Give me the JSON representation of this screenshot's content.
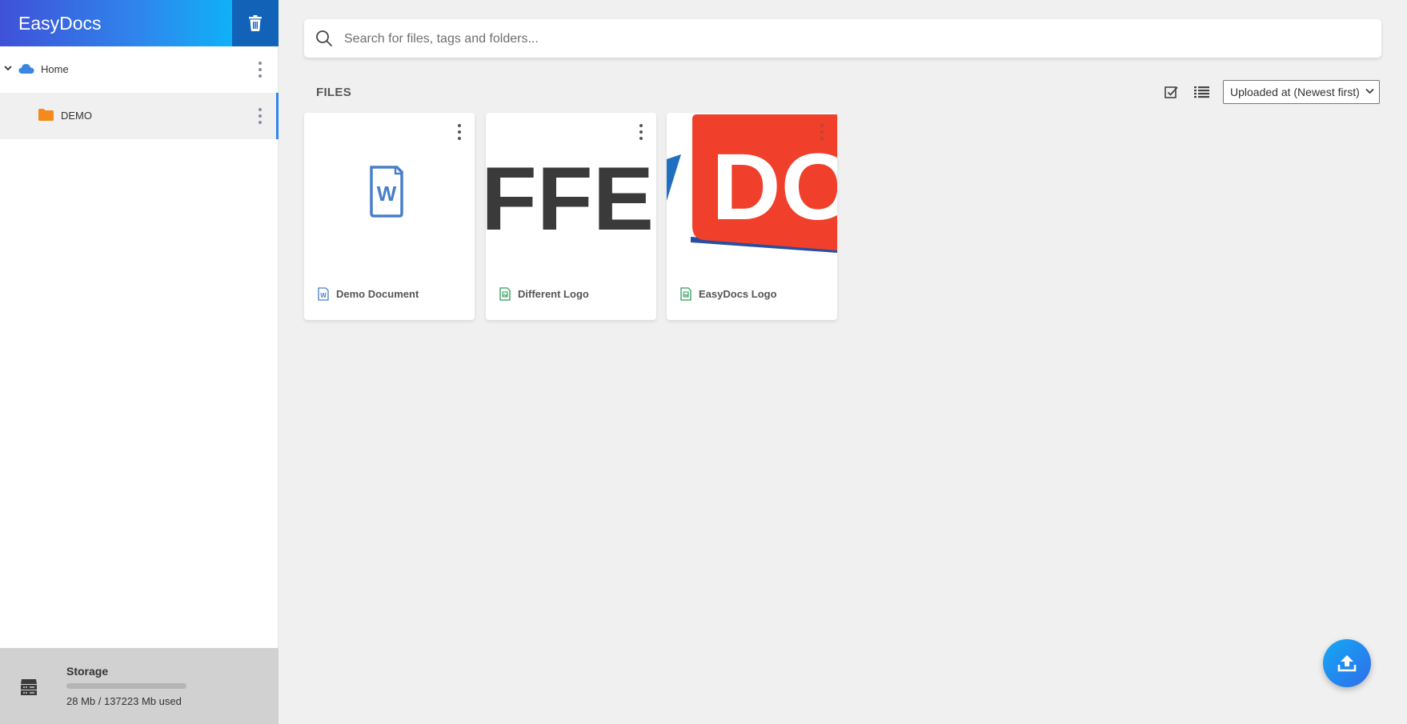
{
  "app": {
    "title": "EasyDocs"
  },
  "colors": {
    "brand_start": "#3f51d8",
    "brand_end": "#0fb1f7",
    "folder": "#f38a1e",
    "cloud": "#3a86e0",
    "word": "#4a7fc8",
    "image_icon": "#2e9d5a"
  },
  "sidebar": {
    "trash_icon": "trash-icon",
    "tree": [
      {
        "label": "Home",
        "icon": "cloud-icon",
        "expanded": true
      },
      {
        "label": "DEMO",
        "icon": "folder-icon",
        "selected": true
      }
    ],
    "storage": {
      "title": "Storage",
      "used_text": "28 Mb / 137223 Mb used",
      "used_fraction": 0.0002
    }
  },
  "search": {
    "placeholder": "Search for files, tags and folders..."
  },
  "files": {
    "heading": "FILES",
    "sort_label": "Uploaded at (Newest first)",
    "items": [
      {
        "name": "Demo Document",
        "type": "word",
        "thumb_text": "W"
      },
      {
        "name": "Different Logo",
        "type": "image",
        "thumb_text": "FFE"
      },
      {
        "name": "EasyDocs Logo",
        "type": "image",
        "thumb_text": "DO"
      }
    ]
  },
  "upload_button": {
    "icon": "upload-icon"
  }
}
